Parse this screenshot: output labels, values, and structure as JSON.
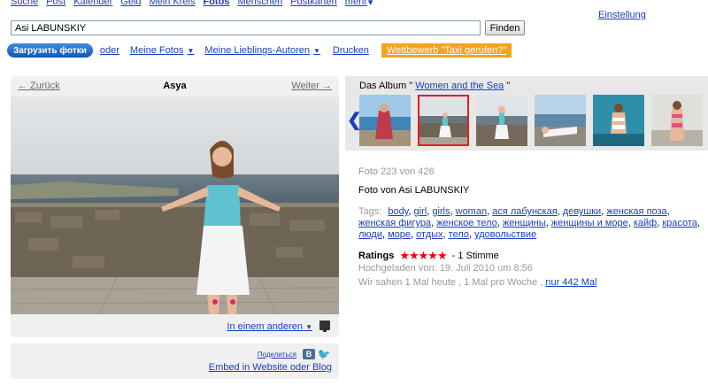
{
  "nav": {
    "items": [
      "Suche",
      "Post",
      "Kalender",
      "Geld",
      "Mein Kreis",
      "Fotos",
      "Menschen",
      "Postkarten",
      "mehr"
    ],
    "active": "Fotos",
    "settings": "Einstellung"
  },
  "search": {
    "value": "Asi LABUNSKIY",
    "button": "Finden"
  },
  "toolbar": {
    "upload": "Загрузить фотки",
    "oder": "oder",
    "my_photos": "Meine Fotos",
    "fav_authors": "Meine Lieblings-Autoren",
    "print": "Drucken",
    "promo": "Wettbewerb \"Taxi gerufen?\""
  },
  "photo_nav": {
    "prev": "← Zurück",
    "title": "Asya",
    "next": "Weiter →"
  },
  "photo_actions": {
    "other": "In einem anderen"
  },
  "share": {
    "label": "Поделиться",
    "vk": "В",
    "embed": "Embed in Website oder Blog"
  },
  "album": {
    "prefix": "Das Album \"",
    "name": "Women and the Sea",
    "suffix": "\""
  },
  "info": {
    "counter": "Foto 223 von 426",
    "byline": "Foto von Asi LABUNSKIY",
    "tags_label": "Tags:",
    "tags": [
      "body",
      "girl",
      "girls",
      "woman",
      "ася лабунская",
      "девушки",
      "женская поза",
      "женская фигура",
      "женское тело",
      "женщины",
      "женщины и море",
      "кайф",
      "красота",
      "люди",
      "море",
      "отдых",
      "тело",
      "удовольствие"
    ],
    "ratings_label": "Ratings",
    "stars": "★★★★★",
    "votes": "- 1 Stimme",
    "uploaded": "Hochgeladen von:  19. Juli 2010 um 8:56",
    "seen_prefix": "Wir sahen  1 Mal heute , 1 Mal pro Woche , ",
    "seen_link": "nur 442 Mal"
  }
}
